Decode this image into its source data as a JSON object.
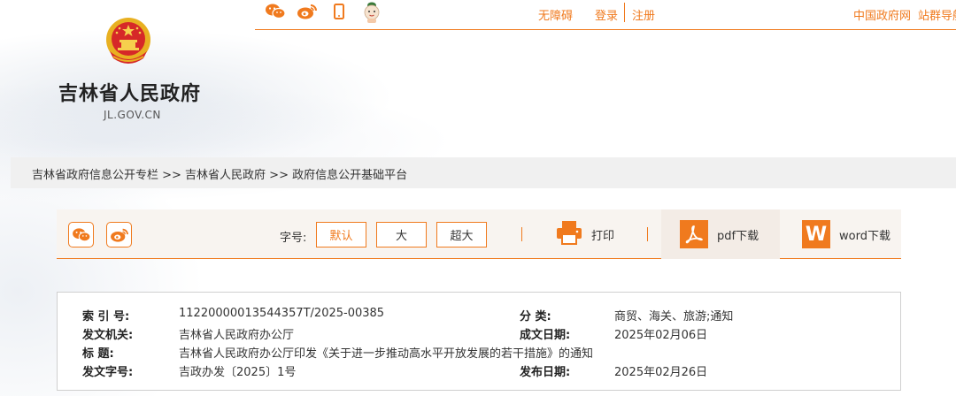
{
  "colors": {
    "accent": "#f07a1e",
    "panel_border": "#cfcfcf",
    "breadcrumb_bg": "#f0f0f0"
  },
  "topbar": {
    "icons": [
      "wechat-icon",
      "weibo-icon",
      "mobile-icon",
      "assistant-avatar-icon"
    ],
    "accessibility": "无障碍",
    "login": "登录",
    "register": "注册",
    "gov_site": "中国政府网",
    "site_nav": "站群导航"
  },
  "site": {
    "title": "吉林省人民政府",
    "domain": "JL.GOV.CN"
  },
  "breadcrumb": "吉林省政府信息公开专栏 >> 吉林省人民政府 >> 政府信息公开基础平台",
  "toolbar": {
    "share_icons": [
      "wechat-icon",
      "weibo-icon"
    ],
    "font_label": "字号:",
    "font_sizes": [
      "默认",
      "大",
      "超大"
    ],
    "selected_font_size": "默认",
    "print": "打印",
    "pdf": "pdf下载",
    "word": "word下载",
    "word_icon_letter": "W"
  },
  "info": {
    "index_label": "索 引 号:",
    "index_value": "11220000013544357T/2025-00385",
    "category_label": "分  类:",
    "category_value": "商贸、海关、旅游;通知",
    "issuer_label": "发文机关:",
    "issuer_value": "吉林省人民政府办公厅",
    "written_date_label": "成文日期:",
    "written_date_value": "2025年02月06日",
    "title_label": "标    题:",
    "title_value": "吉林省人民政府办公厅印发《关于进一步推动高水平开放发展的若干措施》的通知",
    "doc_no_label": "发文字号:",
    "doc_no_value": "吉政办发〔2025〕1号",
    "publish_date_label": "发布日期:",
    "publish_date_value": "2025年02月26日"
  }
}
